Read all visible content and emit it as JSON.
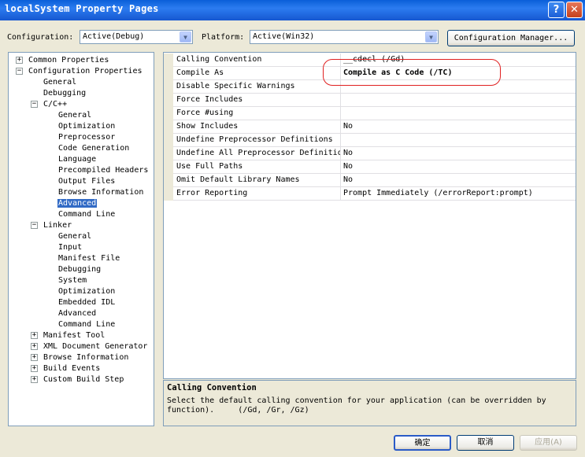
{
  "window": {
    "title": "localSystem Property Pages"
  },
  "config_bar": {
    "configuration_label": "Configuration:",
    "configuration_value": "Active(Debug)",
    "platform_label": "Platform:",
    "platform_value": "Active(Win32)",
    "config_manager_label": "Configuration Manager..."
  },
  "tree": [
    {
      "label": "Common Properties",
      "expander": "+"
    },
    {
      "label": "Configuration Properties",
      "expander": "−"
    },
    {
      "label": "General"
    },
    {
      "label": "Debugging"
    },
    {
      "label": "C/C++",
      "expander": "−"
    },
    {
      "label": "General"
    },
    {
      "label": "Optimization"
    },
    {
      "label": "Preprocessor"
    },
    {
      "label": "Code Generation"
    },
    {
      "label": "Language"
    },
    {
      "label": "Precompiled Headers"
    },
    {
      "label": "Output Files"
    },
    {
      "label": "Browse Information"
    },
    {
      "label": "Advanced",
      "selected": true
    },
    {
      "label": "Command Line"
    },
    {
      "label": "Linker",
      "expander": "−"
    },
    {
      "label": "General"
    },
    {
      "label": "Input"
    },
    {
      "label": "Manifest File"
    },
    {
      "label": "Debugging"
    },
    {
      "label": "System"
    },
    {
      "label": "Optimization"
    },
    {
      "label": "Embedded IDL"
    },
    {
      "label": "Advanced"
    },
    {
      "label": "Command Line"
    },
    {
      "label": "Manifest Tool",
      "expander": "+"
    },
    {
      "label": "XML Document Generator",
      "expander": "+"
    },
    {
      "label": "Browse Information",
      "expander": "+"
    },
    {
      "label": "Build Events",
      "expander": "+"
    },
    {
      "label": "Custom Build Step",
      "expander": "+"
    }
  ],
  "properties": [
    {
      "name": "Calling Convention",
      "value": "__cdecl (/Gd)"
    },
    {
      "name": "Compile As",
      "value": "Compile as C Code (/TC)",
      "bold": true
    },
    {
      "name": "Disable Specific Warnings",
      "value": ""
    },
    {
      "name": "Force Includes",
      "value": ""
    },
    {
      "name": "Force #using",
      "value": ""
    },
    {
      "name": "Show Includes",
      "value": "No"
    },
    {
      "name": "Undefine Preprocessor Definitions",
      "value": ""
    },
    {
      "name": "Undefine All Preprocessor Definitions",
      "value": "No"
    },
    {
      "name": "Use Full Paths",
      "value": "No"
    },
    {
      "name": "Omit Default Library Names",
      "value": "No"
    },
    {
      "name": "Error Reporting",
      "value": "Prompt Immediately (/errorReport:prompt)"
    }
  ],
  "description": {
    "title": "Calling Convention",
    "text": "Select the default calling convention for your application (can be overridden by\nfunction).     (/Gd, /Gr, /Gz)"
  },
  "buttons": {
    "ok": "确定",
    "cancel": "取消",
    "apply": "应用(A)"
  },
  "colors": {
    "titlebar": "#0A5FD8",
    "selection": "#316AC5",
    "highlight_ring": "#E02020"
  }
}
